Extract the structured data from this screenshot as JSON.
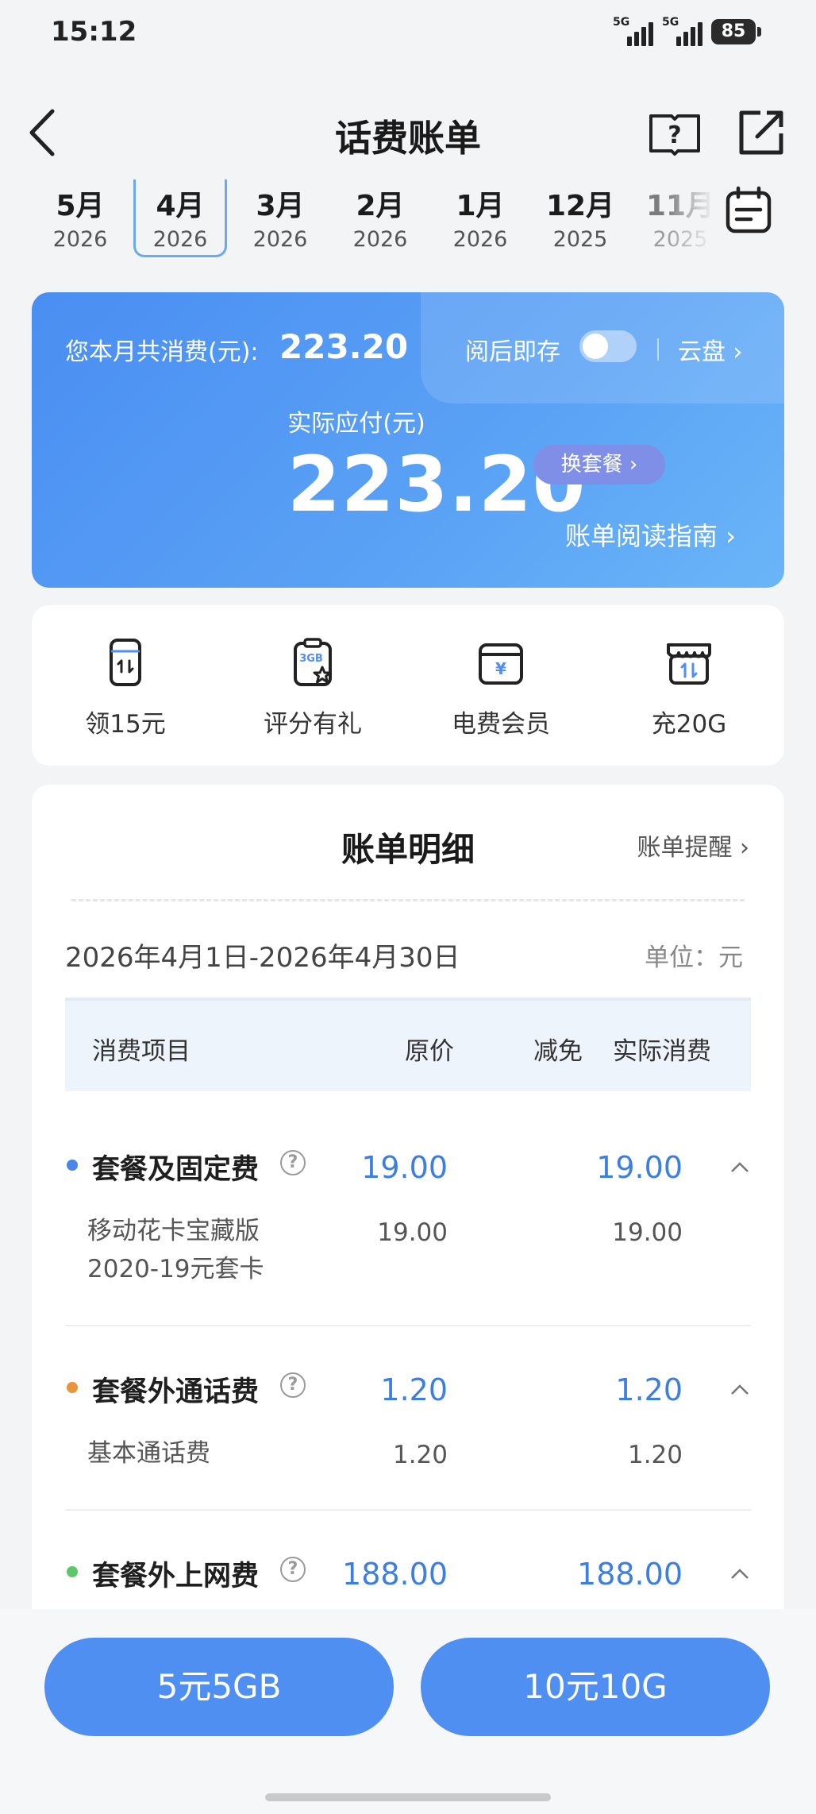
{
  "status": {
    "time": "15:12",
    "sim1": "5G",
    "sim2": "5G",
    "battery": "85"
  },
  "header": {
    "title": "话费账单",
    "help_icon": "help-book-icon",
    "share_icon": "share-icon"
  },
  "months": [
    {
      "m": "5月",
      "y": "2026"
    },
    {
      "m": "4月",
      "y": "2026"
    },
    {
      "m": "3月",
      "y": "2026"
    },
    {
      "m": "2月",
      "y": "2026"
    },
    {
      "m": "1月",
      "y": "2026"
    },
    {
      "m": "12月",
      "y": "2025"
    },
    {
      "m": "11月",
      "y": "2025"
    }
  ],
  "bill": {
    "total_label": "您本月共消费(元):",
    "total_value": "223.20",
    "save_label": "阅后即存",
    "cloud_label": "云盘 ›",
    "due_label": "实际应付(元)",
    "due_value": "223.20",
    "plan_button": "换套餐 ›",
    "guide_link": "账单阅读指南 ›"
  },
  "quick_actions": [
    {
      "label": "领15元",
      "icon": "sim-transfer-icon"
    },
    {
      "label": "评分有礼",
      "icon": "3gb-star-icon"
    },
    {
      "label": "电费会员",
      "icon": "yuan-box-icon"
    },
    {
      "label": "充20G",
      "icon": "store-transfer-icon"
    }
  ],
  "detail": {
    "title": "账单明细",
    "remind": "账单提醒 ›",
    "period": "2026年4月1日-2026年4月30日",
    "unit": "单位：元",
    "columns": [
      "消费项目",
      "原价",
      "减免",
      "实际消费"
    ],
    "categories": [
      {
        "name": "套餐及固定费",
        "dot": "#4a86e8",
        "original": "19.00",
        "actual": "19.00",
        "items": [
          {
            "line1": "移动花卡宝藏版",
            "line2": "2020-19元套卡",
            "original": "19.00",
            "actual": "19.00"
          }
        ]
      },
      {
        "name": "套餐外通话费",
        "dot": "#e8953c",
        "original": "1.20",
        "actual": "1.20",
        "items": [
          {
            "line1": "基本通话费",
            "original": "1.20",
            "actual": "1.20"
          }
        ]
      },
      {
        "name": "套餐外上网费",
        "dot": "#5cc86a",
        "original": "188.00",
        "actual": "188.00",
        "items": []
      }
    ]
  },
  "bottom": {
    "left_button": "5元5GB",
    "right_button": "10元10G"
  },
  "colors": {
    "accent": "#4f8ff2",
    "value_blue": "#3d7fe0"
  }
}
